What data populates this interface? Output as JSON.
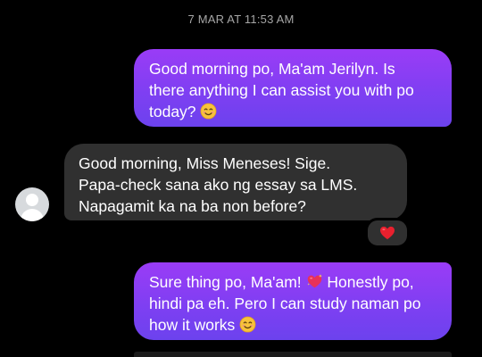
{
  "timestamp": "7 MAR AT 11:53 AM",
  "messages": [
    {
      "sender": "me",
      "text": "Good morning po, Ma'am Jerilyn. Is\nthere anything I can assist you with po\ntoday?",
      "trailing_emoji": "smiling-face-emoji"
    },
    {
      "sender": "contact",
      "text": "Good morning, Miss Meneses! Sige.\nPapa-check sana ako ng essay sa LMS.\nNapagamit ka na ba non before?",
      "reaction": "red-heart-emoji"
    },
    {
      "sender": "me",
      "text_before_emoji": "Sure thing po, Ma'am!",
      "inline_emoji": "sparkling-heart-emoji",
      "text_after_emoji": " Honestly po,\nhindi pa eh. Pero I can study naman po\nhow it works",
      "trailing_emoji": "smiling-face-emoji"
    }
  ],
  "colors": {
    "background": "#000000",
    "outgoing_bubble": "#8a3ef4",
    "incoming_bubble": "#303030",
    "timestamp_text": "#a6a6a6",
    "avatar_placeholder": "#d7dadd"
  }
}
